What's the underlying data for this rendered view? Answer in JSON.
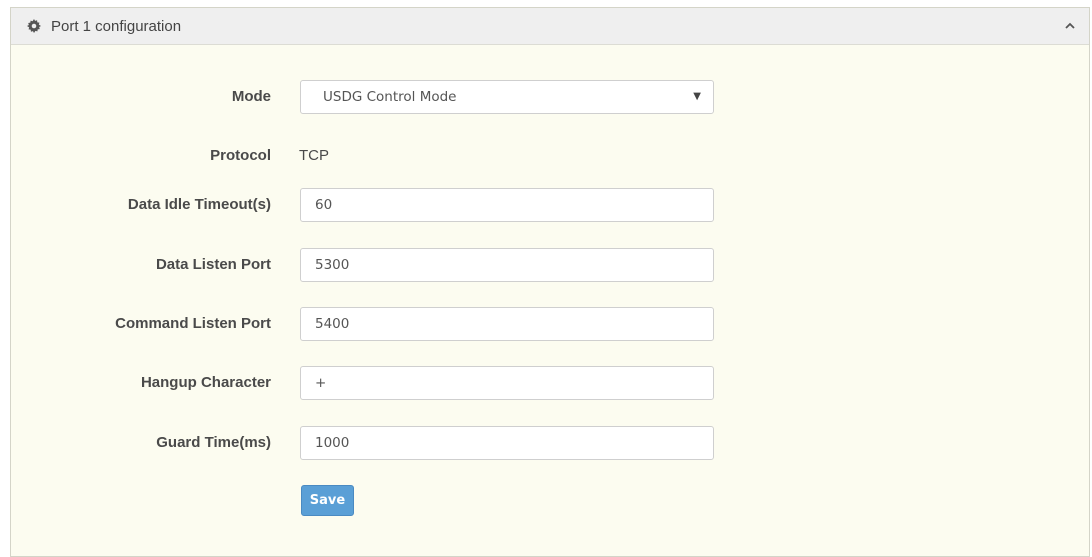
{
  "panel": {
    "title": "Port 1 configuration",
    "header_icon": "gear-icon",
    "collapse_icon": "chevron-up-icon"
  },
  "form": {
    "mode": {
      "label": "Mode",
      "value": "USDG Control Mode"
    },
    "protocol": {
      "label": "Protocol",
      "value": "TCP"
    },
    "data_idle_timeout": {
      "label": "Data Idle Timeout(s)",
      "value": "60"
    },
    "data_listen_port": {
      "label": "Data Listen Port",
      "value": "5300"
    },
    "command_listen_port": {
      "label": "Command Listen Port",
      "value": "5400"
    },
    "hangup_character": {
      "label": "Hangup Character",
      "value": "+"
    },
    "guard_time": {
      "label": "Guard Time(ms)",
      "value": "1000"
    }
  },
  "actions": {
    "save_label": "Save"
  },
  "colors": {
    "save_button": "#5a9fd6",
    "panel_bg": "#fcfcf0",
    "header_bg": "#efefef"
  }
}
